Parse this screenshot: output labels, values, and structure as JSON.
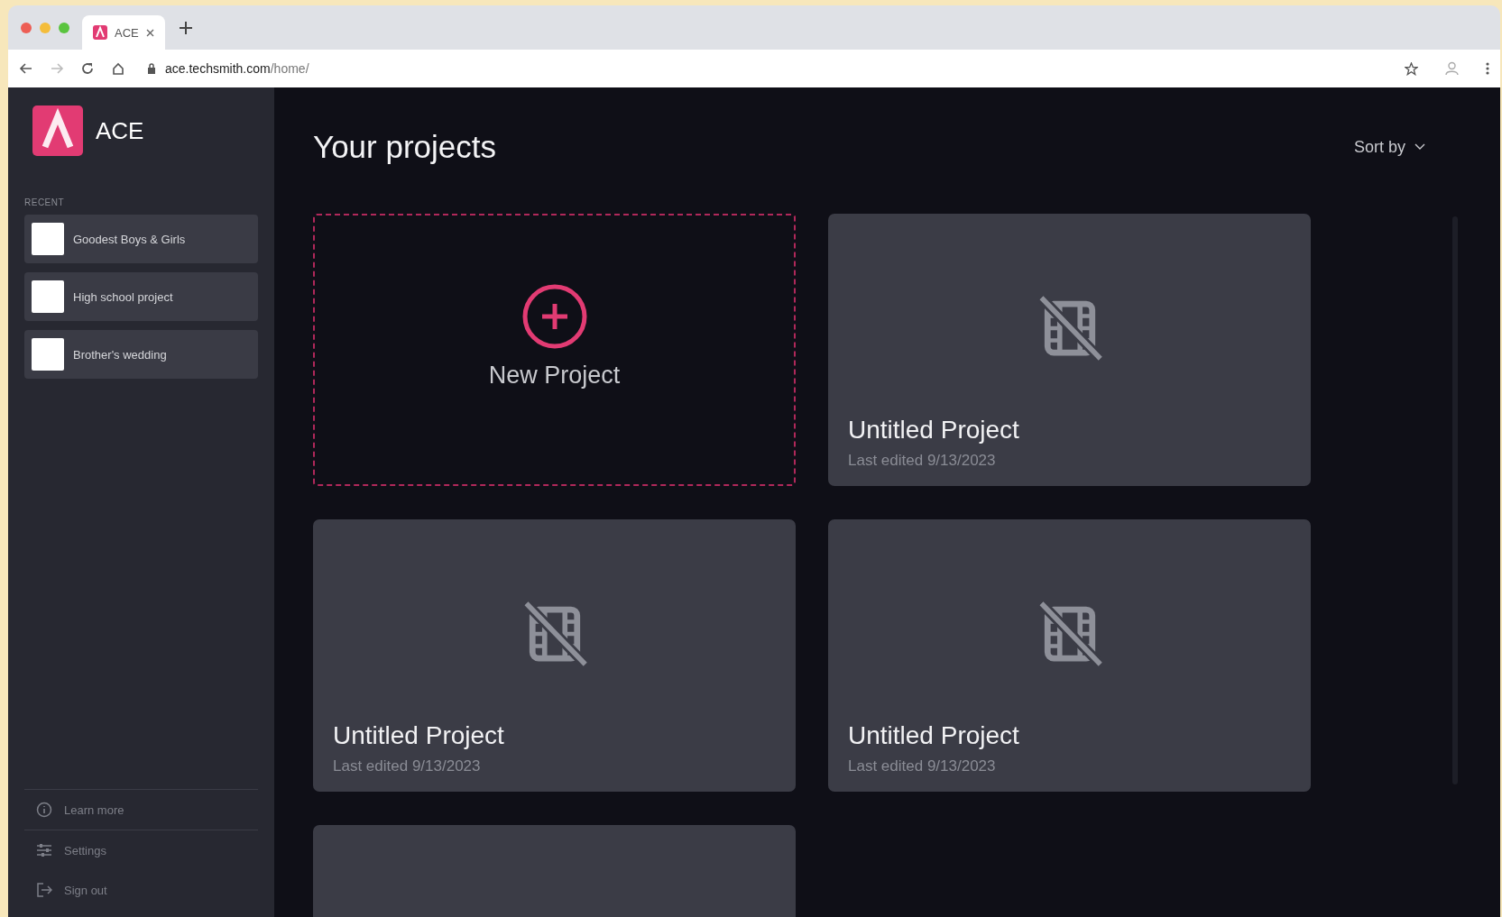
{
  "browser": {
    "tabs": [
      {
        "title": "ACE",
        "selected": true
      }
    ],
    "url_host": "ace.techsmith.com",
    "url_path": "/home/"
  },
  "sidebar": {
    "app_name": "ACE",
    "recent_label": "RECENT",
    "recent": [
      {
        "name": "Goodest Boys & Girls"
      },
      {
        "name": "High school project"
      },
      {
        "name": "Brother's wedding"
      }
    ],
    "footer": [
      {
        "kind": "info",
        "label": "Learn more"
      },
      {
        "kind": "settings",
        "label": "Settings"
      },
      {
        "kind": "signout",
        "label": "Sign out"
      }
    ]
  },
  "main": {
    "title": "Your projects",
    "sort_label": "Sort by",
    "new_project": "New Project",
    "projects": [
      {
        "kind": "project",
        "title": "Untitled Project",
        "last_edited": "Last edited 9/13/2023"
      },
      {
        "kind": "project",
        "title": "Untitled Project",
        "last_edited": "Last edited 9/13/2023"
      },
      {
        "kind": "project",
        "title": "Untitled Project",
        "last_edited": "Last edited 9/13/2023"
      },
      {
        "kind": "cut_off"
      }
    ]
  }
}
